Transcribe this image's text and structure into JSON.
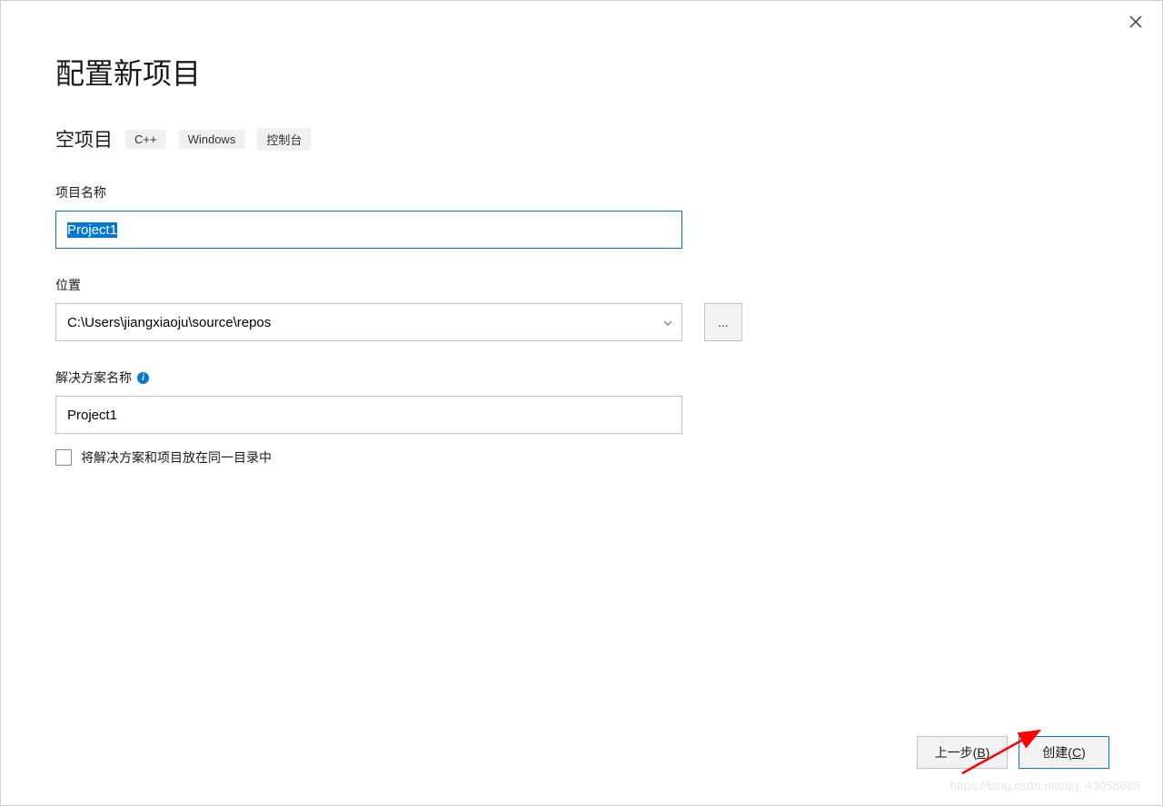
{
  "header": {
    "title": "配置新项目",
    "subtitle": "空项目",
    "tags": [
      "C++",
      "Windows",
      "控制台"
    ]
  },
  "fields": {
    "project_name": {
      "label": "项目名称",
      "value": "Project1"
    },
    "location": {
      "label": "位置",
      "value": "C:\\Users\\jiangxiaoju\\source\\repos",
      "browse": "..."
    },
    "solution_name": {
      "label": "解决方案名称",
      "value": "Project1"
    },
    "same_directory": {
      "label": "将解决方案和项目放在同一目录中",
      "checked": false
    }
  },
  "footer": {
    "back": {
      "prefix": "上一步(",
      "hotkey": "B",
      "suffix": ")"
    },
    "create": {
      "prefix": "创建(",
      "hotkey": "C",
      "suffix": ")"
    }
  },
  "watermark": "https://blog.csdn.net/qq_43058685"
}
